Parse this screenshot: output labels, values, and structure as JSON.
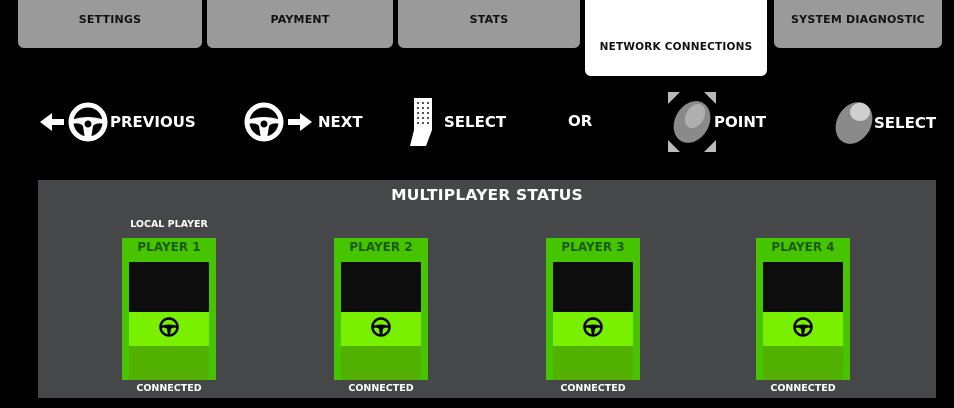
{
  "tabs": [
    {
      "label": "SETTINGS",
      "active": false
    },
    {
      "label": "PAYMENT",
      "active": false
    },
    {
      "label": "STATS",
      "active": false
    },
    {
      "label": "NETWORK CONNECTIONS",
      "active": true
    },
    {
      "label": "SYSTEM DIAGNOSTIC",
      "active": false
    }
  ],
  "controls": {
    "previous": {
      "label": "PREVIOUS",
      "icon": "arrow-left-steering-wheel-icon"
    },
    "next": {
      "label": "NEXT",
      "icon": "steering-wheel-arrow-right-icon"
    },
    "pedal_select": {
      "label": "SELECT",
      "icon": "pedal-icon"
    },
    "or": "OR",
    "point": {
      "label": "POINT",
      "icon": "trackball-point-icon"
    },
    "trackball_select": {
      "label": "SELECT",
      "icon": "trackball-select-icon"
    }
  },
  "panel": {
    "title": "MULTIPLAYER STATUS",
    "players": [
      {
        "name": "PLAYER 1",
        "status": "CONNECTED",
        "local_label": "LOCAL PLAYER"
      },
      {
        "name": "PLAYER 2",
        "status": "CONNECTED"
      },
      {
        "name": "PLAYER 3",
        "status": "CONNECTED"
      },
      {
        "name": "PLAYER 4",
        "status": "CONNECTED"
      }
    ]
  },
  "colors": {
    "background": "#000000",
    "tab_inactive": "#9a9a9a",
    "tab_active": "#ffffff",
    "panel": "#454749",
    "player_green": "#47c400",
    "seat_green": "#78f000",
    "player_name": "#1c5a00"
  }
}
